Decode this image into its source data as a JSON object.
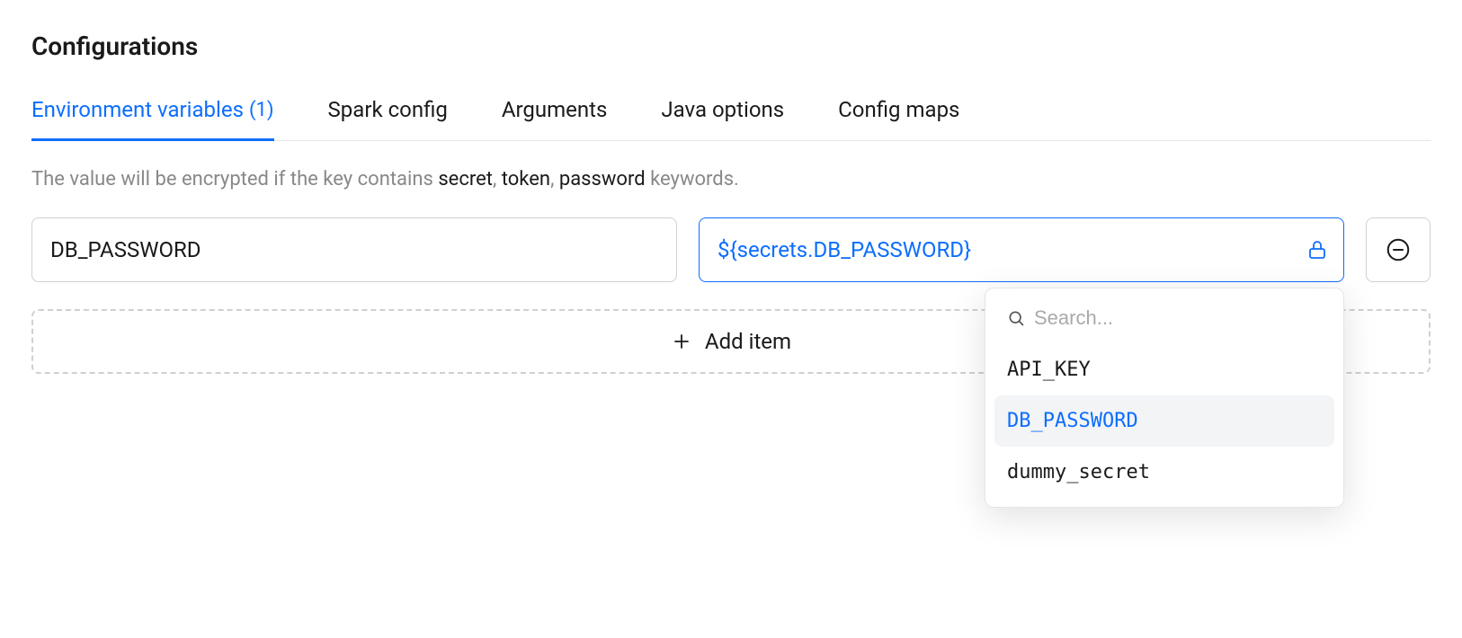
{
  "title": "Configurations",
  "tabs": [
    {
      "label": "Environment variables",
      "count": "(1)",
      "active": true
    },
    {
      "label": "Spark config",
      "active": false
    },
    {
      "label": "Arguments",
      "active": false
    },
    {
      "label": "Java options",
      "active": false
    },
    {
      "label": "Config maps",
      "active": false
    }
  ],
  "helper": {
    "prefix": "The value will be encrypted if the key contains ",
    "kw1": "secret",
    "sep1": ", ",
    "kw2": "token",
    "sep2": ", ",
    "kw3": "password",
    "suffix": " keywords."
  },
  "row": {
    "key": "DB_PASSWORD",
    "value": "${secrets.DB_PASSWORD}"
  },
  "addItem": {
    "label": "Add item"
  },
  "dropdown": {
    "searchPlaceholder": "Search...",
    "items": [
      {
        "label": "API_KEY",
        "selected": false
      },
      {
        "label": "DB_PASSWORD",
        "selected": true
      },
      {
        "label": "dummy_secret",
        "selected": false
      }
    ]
  }
}
